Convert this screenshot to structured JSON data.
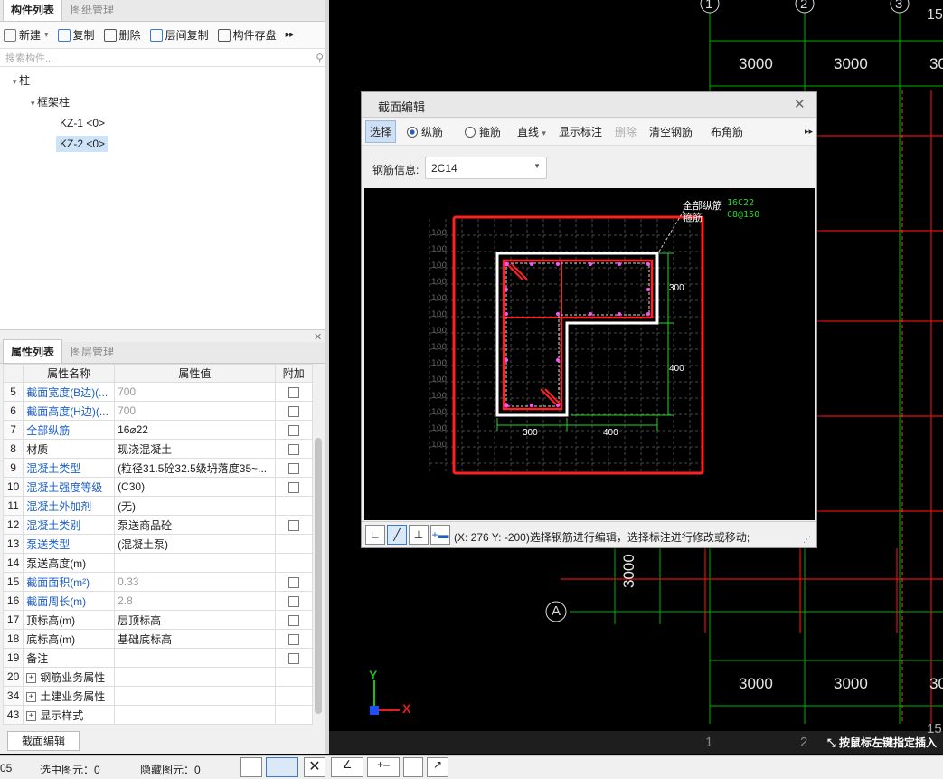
{
  "left_tabs": {
    "tab1": "构件列表",
    "tab2": "图纸管理"
  },
  "toolbar": {
    "new": "新建",
    "copy": "复制",
    "delete": "删除",
    "floor_copy": "层间复制",
    "save": "构件存盘",
    "more": "▸▸"
  },
  "search": {
    "placeholder": "搜索构件..."
  },
  "tree": {
    "root": "柱",
    "group": "框架柱",
    "item1": "KZ-1 <0>",
    "item2": "KZ-2 <0>"
  },
  "prop_tabs": {
    "tab1": "属性列表",
    "tab2": "图层管理"
  },
  "prop_headers": {
    "name": "属性名称",
    "value": "属性值",
    "extra": "附加"
  },
  "props": [
    {
      "n": "5",
      "name": "截面宽度(B边)(...",
      "value": "700"
    },
    {
      "n": "6",
      "name": "截面高度(H边)(...",
      "value": "700"
    },
    {
      "n": "7",
      "name": "全部纵筋",
      "value": "16⌀22"
    },
    {
      "n": "8",
      "name": "材质",
      "value": "现浇混凝土"
    },
    {
      "n": "9",
      "name": "混凝土类型",
      "value": "(粒径31.5砼32.5级坍落度35~..."
    },
    {
      "n": "10",
      "name": "混凝土强度等级",
      "value": "(C30)"
    },
    {
      "n": "11",
      "name": "混凝土外加剂",
      "value": "(无)"
    },
    {
      "n": "12",
      "name": "混凝土类别",
      "value": "泵送商品砼"
    },
    {
      "n": "13",
      "name": "泵送类型",
      "value": "(混凝土泵)"
    },
    {
      "n": "14",
      "name": "泵送高度(m)",
      "value": ""
    },
    {
      "n": "15",
      "name": "截面面积(m²)",
      "value": "0.33"
    },
    {
      "n": "16",
      "name": "截面周长(m)",
      "value": "2.8"
    },
    {
      "n": "17",
      "name": "顶标高(m)",
      "value": "层顶标高"
    },
    {
      "n": "18",
      "name": "底标高(m)",
      "value": "基础底标高"
    },
    {
      "n": "19",
      "name": "备注",
      "value": ""
    },
    {
      "n": "20",
      "name": "钢筋业务属性",
      "value": ""
    },
    {
      "n": "34",
      "name": "土建业务属性",
      "value": ""
    },
    {
      "n": "43",
      "name": "显示样式",
      "value": ""
    }
  ],
  "section_edit_btn": "截面编辑",
  "status": {
    "left": "05",
    "selected": "选中图元：0",
    "hidden": "隐藏图元：0"
  },
  "dialog": {
    "title": "截面编辑",
    "select": "选择",
    "radio1": "纵筋",
    "radio2": "箍筋",
    "line": "直线",
    "show_dim": "显示标注",
    "delete": "删除",
    "clear": "清空钢筋",
    "corner": "布角筋",
    "rebar_info_label": "钢筋信息:",
    "rebar_info_value": "2C14",
    "legend_l1": "全部纵筋",
    "legend_l2": "箍筋",
    "legend_v1": "16C22",
    "legend_v2": "C8@150",
    "dim_300a": "300",
    "dim_400a": "400",
    "dim_300b": "300",
    "dim_400b": "400",
    "grid_label": "100",
    "status": "(X: 276 Y: -200)选择钢筋进行编辑，选择标注进行修改或移动;"
  },
  "cad": {
    "axis1": "1",
    "axis2": "2",
    "axis3": "3",
    "axis1b": "1",
    "axis2b": "2",
    "axisA": "A",
    "dim_top1": "3000",
    "dim_top2": "3000",
    "dim_top3": "30",
    "dim_bot1": "3000",
    "dim_bot2": "3000",
    "dim_bot3": "30",
    "dim_vert": "3000",
    "corner_top": "15",
    "corner_bot": "15",
    "y_axis": "Y",
    "x_axis": "X",
    "hint": "按鼠标左键指定插入"
  }
}
